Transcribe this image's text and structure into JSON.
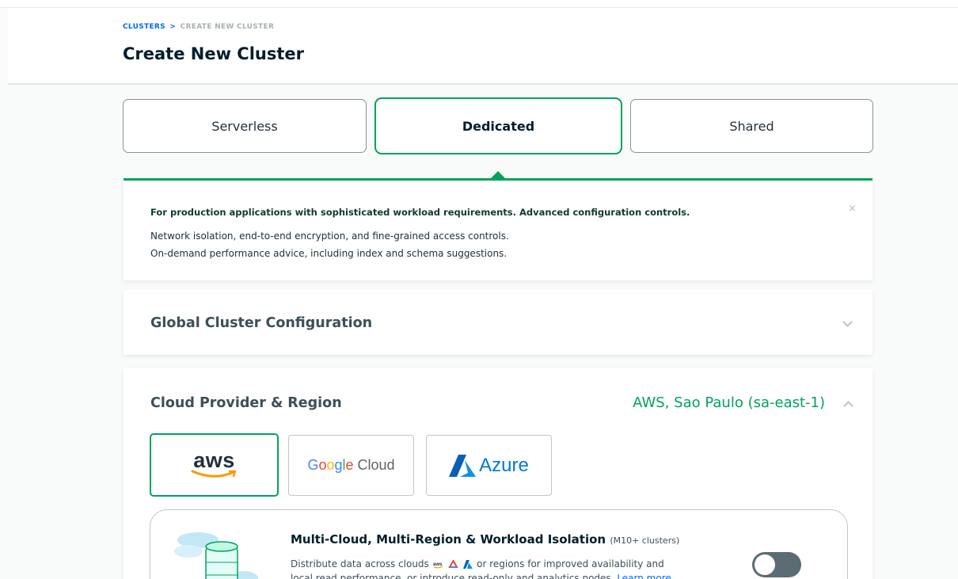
{
  "breadcrumb": {
    "link": "CLUSTERS",
    "separator": ">",
    "current": "CREATE NEW CLUSTER"
  },
  "page_title": "Create New Cluster",
  "tiers": [
    {
      "label": "Serverless",
      "selected": false
    },
    {
      "label": "Dedicated",
      "selected": true
    },
    {
      "label": "Shared",
      "selected": false
    }
  ],
  "info": {
    "headline": "For production applications with sophisticated workload requirements. Advanced configuration controls.",
    "lines": [
      "Network isolation, end-to-end encryption, and fine-grained access controls.",
      "On-demand performance advice, including index and schema suggestions."
    ],
    "close": "×"
  },
  "global_config": {
    "title": "Global Cluster Configuration",
    "expanded": false
  },
  "provider_section": {
    "title": "Cloud Provider & Region",
    "summary": "AWS, Sao Paulo (sa-east-1)",
    "expanded": true,
    "providers": [
      {
        "name": "aws",
        "selected": true
      },
      {
        "name": "Google Cloud",
        "selected": false
      },
      {
        "name": "Azure",
        "selected": false
      }
    ],
    "feature": {
      "title": "Multi-Cloud, Multi-Region & Workload Isolation",
      "note": "(M10+ clusters)",
      "desc_before": "Distribute data across clouds",
      "desc_after": "or regions for improved availability and",
      "desc_line2": "local read performance, or introduce read-only and analytics nodes.",
      "learn_more": "Learn more",
      "enabled": false
    }
  },
  "colors": {
    "accent": "#00a35c",
    "link": "#016bf8",
    "toggle_off": "#5c6c75"
  }
}
